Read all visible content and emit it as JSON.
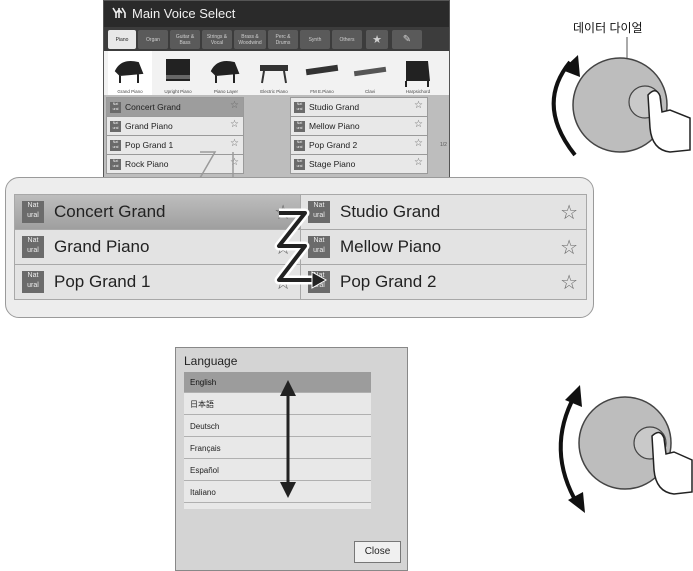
{
  "main_voice_select": {
    "title": "Main Voice Select",
    "tabs": [
      {
        "label": "Piano",
        "active": true
      },
      {
        "label": "Organ"
      },
      {
        "label": "Guitar & Bass"
      },
      {
        "label": "Strings & Vocal"
      },
      {
        "label": "Brass & Woodwind"
      },
      {
        "label": "Perc & Drums"
      },
      {
        "label": "Synth"
      },
      {
        "label": "Others"
      }
    ],
    "categories": [
      {
        "label": "Grand Piano",
        "active": true
      },
      {
        "label": "Upright Piano"
      },
      {
        "label": "Piano Layer"
      },
      {
        "label": "Electric Piano"
      },
      {
        "label": "FM E.Piano"
      },
      {
        "label": "Clavi"
      },
      {
        "label": "Harpsichord"
      }
    ],
    "voices_left": [
      {
        "name": "Concert Grand",
        "selected": true
      },
      {
        "name": "Grand Piano"
      },
      {
        "name": "Pop Grand 1"
      },
      {
        "name": "Rock Piano"
      }
    ],
    "voices_right": [
      {
        "name": "Studio Grand"
      },
      {
        "name": "Mellow Piano"
      },
      {
        "name": "Pop Grand 2"
      },
      {
        "name": "Stage Piano"
      }
    ],
    "page_indicator": "1/2"
  },
  "zoom_panel": {
    "left": [
      {
        "name": "Concert Grand",
        "selected": true
      },
      {
        "name": "Grand Piano"
      },
      {
        "name": "Pop Grand 1"
      }
    ],
    "right": [
      {
        "name": "Studio Grand"
      },
      {
        "name": "Mellow Piano"
      },
      {
        "name": "Pop Grand 2"
      }
    ]
  },
  "badge_text": "Nat ural",
  "star_glyph": "☆",
  "language_dialog": {
    "title": "Language",
    "options": [
      "English",
      "日本語",
      "Deutsch",
      "Français",
      "Español",
      "Italiano"
    ],
    "selected": "English",
    "close_label": "Close"
  },
  "data_dial_caption": "데이터 다이얼"
}
